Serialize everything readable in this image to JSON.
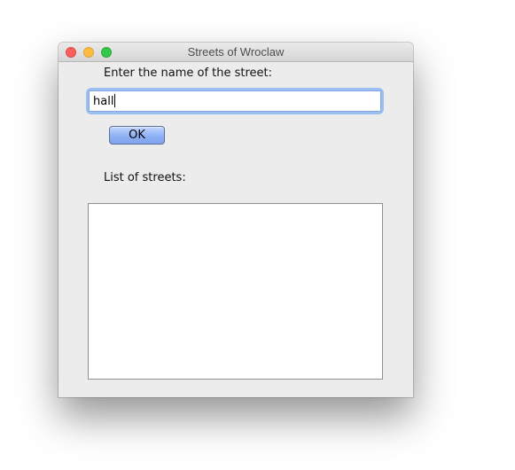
{
  "window": {
    "title": "Streets of Wroclaw",
    "controls": [
      "close",
      "minimize",
      "zoom"
    ]
  },
  "form": {
    "street_label": "Enter the name of the street:",
    "street_value": "hall",
    "ok_label": "OK",
    "list_label": "List of streets:",
    "list_items": []
  },
  "colors": {
    "window_bg": "#ececec",
    "focus_ring": "#9bbff0",
    "button_blue": "#8eb0f4",
    "close": "#fc605c",
    "minimize": "#fdbc40",
    "zoom": "#34c84a"
  }
}
